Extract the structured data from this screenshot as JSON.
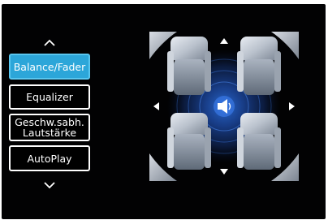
{
  "menu": {
    "items": [
      {
        "id": "balance-fader",
        "label": "Balance/Fader",
        "active": true
      },
      {
        "id": "equalizer",
        "label": "Equalizer",
        "active": false
      },
      {
        "id": "speed-volume",
        "label": "Geschw.sabh.\nLautstärke",
        "active": false
      },
      {
        "id": "autoplay",
        "label": "AutoPlay",
        "active": false
      }
    ]
  },
  "colors": {
    "background": "#020203",
    "accent": "#2ca6d9",
    "button_border": "#ffffff",
    "text": "#ffffff"
  },
  "icons": {
    "scroll_up": "chevron-up-icon",
    "scroll_down": "chevron-down-icon",
    "center": "speaker-icon",
    "arrows": [
      "arrow-up-icon",
      "arrow-down-icon",
      "arrow-left-icon",
      "arrow-right-icon"
    ]
  }
}
